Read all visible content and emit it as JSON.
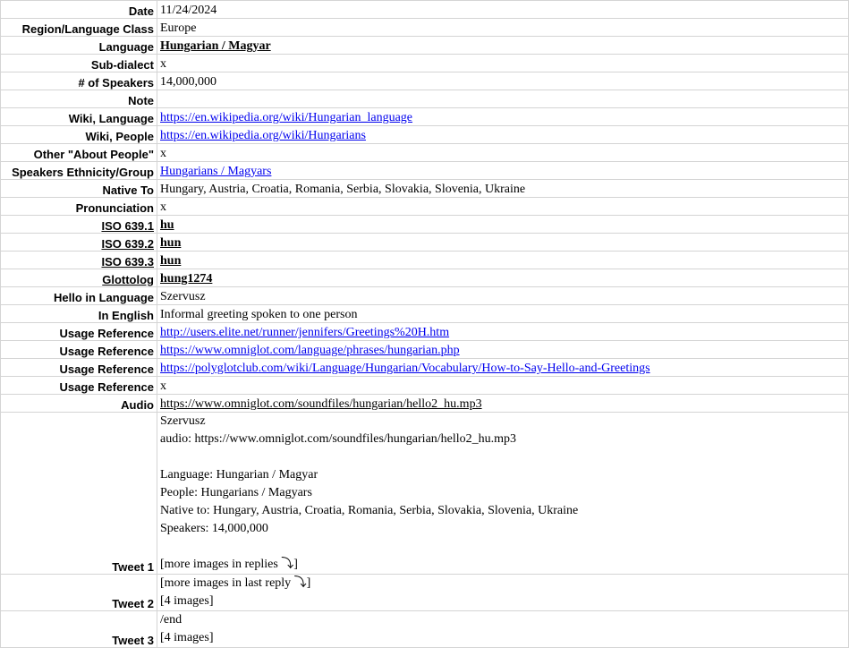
{
  "rows": {
    "date": {
      "label": "Date",
      "value": "11/24/2024"
    },
    "region": {
      "label": "Region/Language Class",
      "value": "Europe"
    },
    "language": {
      "label": "Language",
      "value": "Hungarian / Magyar",
      "color": "#c00000"
    },
    "subdialect": {
      "label": "Sub-dialect",
      "value": "x"
    },
    "speakers": {
      "label": "# of Speakers",
      "value": "14,000,000"
    },
    "note": {
      "label": "Note",
      "value": ""
    },
    "wiki_language": {
      "label": "Wiki, Language",
      "value": "https://en.wikipedia.org/wiki/Hungarian_language"
    },
    "wiki_people": {
      "label": "Wiki, People",
      "value": "https://en.wikipedia.org/wiki/Hungarians"
    },
    "other_about": {
      "label": "Other \"About People\"",
      "value": "x"
    },
    "ethnicity": {
      "label": "Speakers Ethnicity/Group",
      "value": "Hungarians / Magyars"
    },
    "native_to": {
      "label": "Native To",
      "value": "Hungary, Austria, Croatia, Romania, Serbia, Slovakia, Slovenia, Ukraine"
    },
    "pronunciation": {
      "label": "Pronunciation",
      "value": "x"
    },
    "iso1": {
      "label": "ISO 639.1",
      "value": "hu",
      "color": "#e47c2a"
    },
    "iso2": {
      "label": "ISO 639.2",
      "value": "hun"
    },
    "iso3": {
      "label": "ISO 639.3",
      "value": "hun"
    },
    "glottolog": {
      "label": "Glottolog",
      "value": "hung1274"
    },
    "hello": {
      "label": "Hello in Language",
      "value": "Szervusz",
      "color": "#a0521e"
    },
    "english": {
      "label": "In English",
      "value": "Informal greeting spoken to one person"
    },
    "usage1": {
      "label": "Usage Reference",
      "value": "http://users.elite.net/runner/jennifers/Greetings%20H.htm"
    },
    "usage2": {
      "label": "Usage Reference",
      "value": "https://www.omniglot.com/language/phrases/hungarian.php"
    },
    "usage3": {
      "label": "Usage Reference",
      "value": "https://polyglotclub.com/wiki/Language/Hungarian/Vocabulary/How-to-Say-Hello-and-Greetings"
    },
    "usage4": {
      "label": "Usage Reference",
      "value": "x"
    },
    "audio": {
      "label": "Audio",
      "value": "https://www.omniglot.com/soundfiles/hungarian/hello2_hu.mp3",
      "color": "#2e7d1f"
    }
  },
  "tweet1": {
    "label": "Tweet 1",
    "lines": [
      "Szervusz",
      "audio: https://www.omniglot.com/soundfiles/hungarian/hello2_hu.mp3",
      "",
      "Language: Hungarian / Magyar",
      "People: Hungarians / Magyars",
      "Native to: Hungary, Austria, Croatia, Romania, Serbia, Slovakia, Slovenia, Ukraine",
      "Speakers: 14,000,000",
      "",
      "[more images in replies ⤵︎]"
    ]
  },
  "tweet2": {
    "label": "Tweet 2",
    "lines": [
      "[more images in last reply ⤵︎]",
      "[4 images]"
    ]
  },
  "tweet3": {
    "label": "Tweet 3",
    "lines": [
      "/end",
      "[4 images]"
    ]
  }
}
